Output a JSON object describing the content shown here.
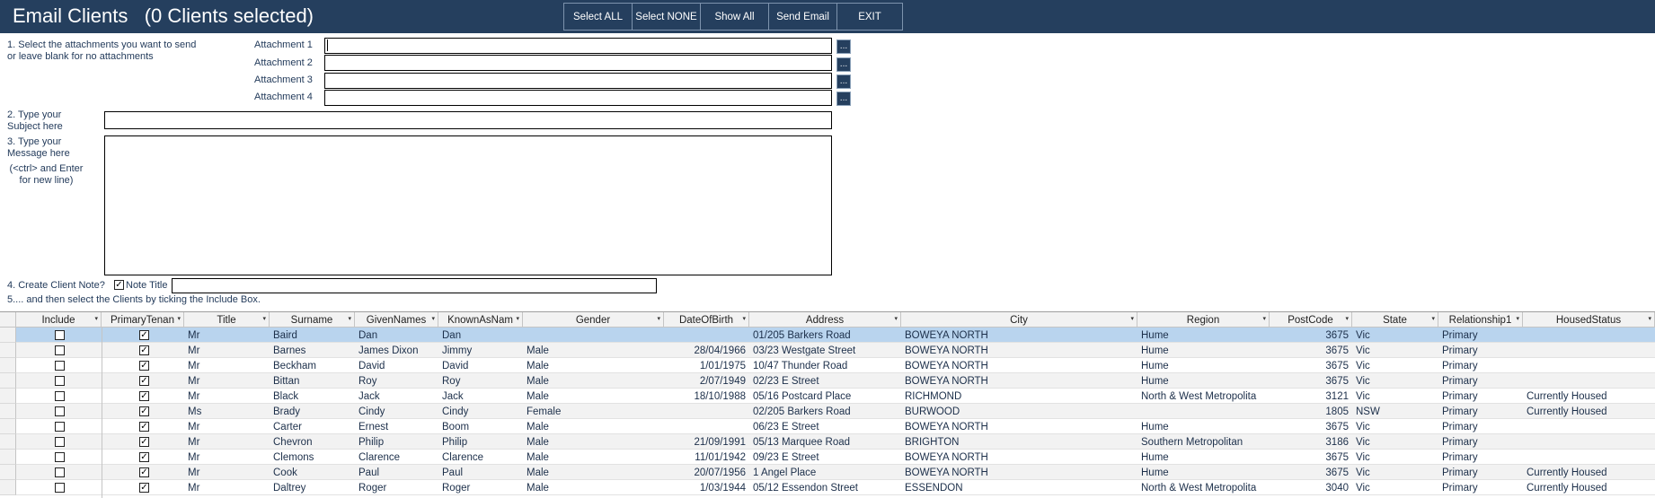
{
  "header": {
    "title": "Email Clients   (0 Clients selected)",
    "buttons": [
      "Select ALL",
      "Select NONE",
      "Show All",
      "Send Email",
      "EXIT"
    ]
  },
  "form": {
    "step1": [
      "1. Select the attachments you want to send",
      "or leave blank for no attachments"
    ],
    "attachments": [
      "Attachment 1",
      "Attachment 2",
      "Attachment 3",
      "Attachment 4"
    ],
    "attachment_values": [
      "",
      "",
      "",
      ""
    ],
    "browse_label": "...",
    "step2": [
      "2. Type your",
      "Subject here"
    ],
    "subject_value": "",
    "step3": [
      "3. Type your",
      "Message here"
    ],
    "step3_hint": [
      "(<ctrl> and Enter",
      "for new line)"
    ],
    "message_value": "",
    "step4": "4. Create Client Note?",
    "note_checked": true,
    "note_title_label": "Note Title",
    "note_title_value": "",
    "step5": "5.... and then select the Clients by ticking the Include Box."
  },
  "grid": {
    "columns": [
      "Include",
      "PrimaryTenan",
      "Title",
      "Surname",
      "GivenNames",
      "KnownAsNam",
      "Gender",
      "DateOfBirth",
      "Address",
      "City",
      "Region",
      "PostCode",
      "State",
      "Relationship1",
      "HousedStatus"
    ],
    "check_mark": "✓",
    "dropdown_glyph": "▾",
    "rows": [
      {
        "include": false,
        "primary": true,
        "title": "Mr",
        "surname": "Baird",
        "given": "Dan",
        "known": "Dan",
        "gender": "",
        "dob": "",
        "address": "01/205 Barkers Road",
        "city": "BOWEYA NORTH",
        "region": "Hume",
        "postcode": "3675",
        "state": "Vic",
        "relationship": "Primary",
        "housed": ""
      },
      {
        "include": false,
        "primary": true,
        "title": "Mr",
        "surname": "Barnes",
        "given": "James Dixon",
        "known": "Jimmy",
        "gender": "Male",
        "dob": "28/04/1966",
        "address": "03/23 Westgate Street",
        "city": "BOWEYA NORTH",
        "region": "Hume",
        "postcode": "3675",
        "state": "Vic",
        "relationship": "Primary",
        "housed": ""
      },
      {
        "include": false,
        "primary": true,
        "title": "Mr",
        "surname": "Beckham",
        "given": "David",
        "known": "David",
        "gender": "Male",
        "dob": "1/01/1975",
        "address": "10/47 Thunder Road",
        "city": "BOWEYA NORTH",
        "region": "Hume",
        "postcode": "3675",
        "state": "Vic",
        "relationship": "Primary",
        "housed": ""
      },
      {
        "include": false,
        "primary": true,
        "title": "Mr",
        "surname": "Bittan",
        "given": "Roy",
        "known": "Roy",
        "gender": "Male",
        "dob": "2/07/1949",
        "address": "02/23 E Street",
        "city": "BOWEYA NORTH",
        "region": "Hume",
        "postcode": "3675",
        "state": "Vic",
        "relationship": "Primary",
        "housed": ""
      },
      {
        "include": false,
        "primary": true,
        "title": "Mr",
        "surname": "Black",
        "given": "Jack",
        "known": "Jack",
        "gender": "Male",
        "dob": "18/10/1988",
        "address": "05/16 Postcard Place",
        "city": "RICHMOND",
        "region": "North & West Metropolita",
        "postcode": "3121",
        "state": "Vic",
        "relationship": "Primary",
        "housed": "Currently Housed"
      },
      {
        "include": false,
        "primary": true,
        "title": "Ms",
        "surname": "Brady",
        "given": "Cindy",
        "known": "Cindy",
        "gender": "Female",
        "dob": "",
        "address": "02/205 Barkers Road",
        "city": "BURWOOD",
        "region": "",
        "postcode": "1805",
        "state": "NSW",
        "relationship": "Primary",
        "housed": "Currently Housed"
      },
      {
        "include": false,
        "primary": true,
        "title": "Mr",
        "surname": "Carter",
        "given": "Ernest",
        "known": "Boom",
        "gender": "Male",
        "dob": "",
        "address": "06/23 E Street",
        "city": "BOWEYA NORTH",
        "region": "Hume",
        "postcode": "3675",
        "state": "Vic",
        "relationship": "Primary",
        "housed": ""
      },
      {
        "include": false,
        "primary": true,
        "title": "Mr",
        "surname": "Chevron",
        "given": "Philip",
        "known": "Philip",
        "gender": "Male",
        "dob": "21/09/1991",
        "address": "05/13 Marquee Road",
        "city": "BRIGHTON",
        "region": "Southern Metropolitan",
        "postcode": "3186",
        "state": "Vic",
        "relationship": "Primary",
        "housed": ""
      },
      {
        "include": false,
        "primary": true,
        "title": "Mr",
        "surname": "Clemons",
        "given": "Clarence",
        "known": "Clarence",
        "gender": "Male",
        "dob": "11/01/1942",
        "address": "09/23 E Street",
        "city": "BOWEYA NORTH",
        "region": "Hume",
        "postcode": "3675",
        "state": "Vic",
        "relationship": "Primary",
        "housed": ""
      },
      {
        "include": false,
        "primary": true,
        "title": "Mr",
        "surname": "Cook",
        "given": "Paul",
        "known": "Paul",
        "gender": "Male",
        "dob": "20/07/1956",
        "address": "1 Angel Place",
        "city": "BOWEYA NORTH",
        "region": "Hume",
        "postcode": "3675",
        "state": "Vic",
        "relationship": "Primary",
        "housed": "Currently Housed"
      },
      {
        "include": false,
        "primary": true,
        "title": "Mr",
        "surname": "Daltrey",
        "given": "Roger",
        "known": "Roger",
        "gender": "Male",
        "dob": "1/03/1944",
        "address": "05/12 Essendon Street",
        "city": "ESSENDON",
        "region": "North & West Metropolita",
        "postcode": "3040",
        "state": "Vic",
        "relationship": "Primary",
        "housed": "Currently Housed"
      }
    ]
  }
}
